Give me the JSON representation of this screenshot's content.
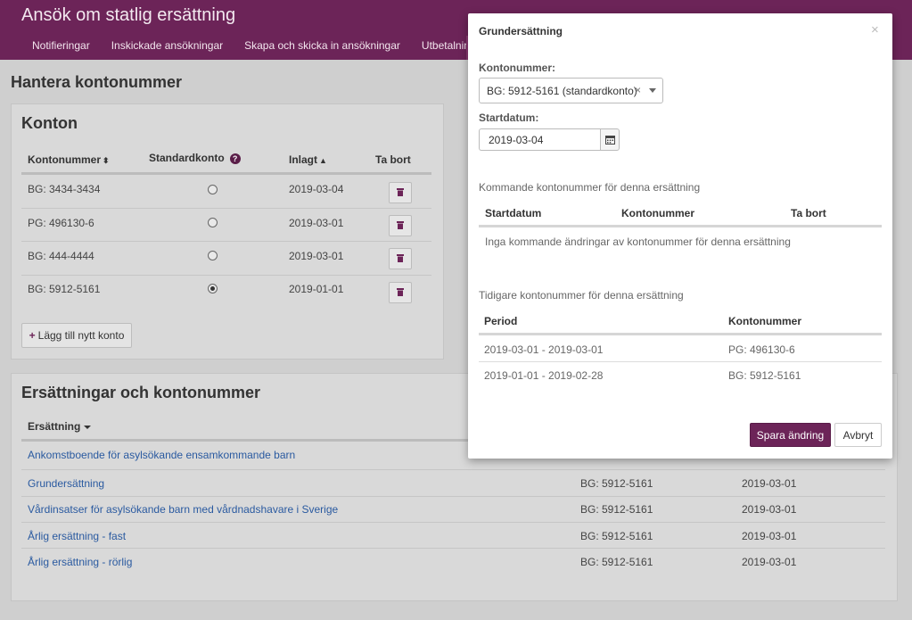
{
  "app": {
    "title": "Ansök om statlig ersättning"
  },
  "nav": [
    "Notifieringar",
    "Inskickade ansökningar",
    "Skapa och skicka in ansökningar",
    "Utbetalningar"
  ],
  "page": {
    "heading": "Hantera kontonummer"
  },
  "konton": {
    "title": "Konton",
    "headers": {
      "kontonummer": "Kontonummer",
      "standardkonto": "Standardkonto",
      "inlagt": "Inlagt",
      "ta_bort": "Ta bort"
    },
    "rows": [
      {
        "kontonummer": "BG: 3434-3434",
        "inlagt": "2019-03-04",
        "standard": false
      },
      {
        "kontonummer": "PG: 496130-6",
        "inlagt": "2019-03-01",
        "standard": false
      },
      {
        "kontonummer": "BG: 444-4444",
        "inlagt": "2019-03-01",
        "standard": false
      },
      {
        "kontonummer": "BG: 5912-5161",
        "inlagt": "2019-01-01",
        "standard": true
      }
    ],
    "add_button": "Lägg till nytt konto"
  },
  "ersattningar": {
    "title": "Ersättningar och kontonummer",
    "header_ersattning": "Ersättning",
    "rows": [
      {
        "name": "Ankomstboende för asylsökande ensamkommande barn",
        "konto": "",
        "datum": ""
      },
      {
        "name": "Grundersättning",
        "konto": "BG: 5912-5161",
        "datum": "2019-03-01"
      },
      {
        "name": "Vårdinsatser för asylsökande barn med vårdnadshavare i Sverige",
        "konto": "BG: 5912-5161",
        "datum": "2019-03-01"
      },
      {
        "name": "Årlig ersättning - fast",
        "konto": "BG: 5912-5161",
        "datum": "2019-03-01"
      },
      {
        "name": "Årlig ersättning - rörlig",
        "konto": "BG: 5912-5161",
        "datum": "2019-03-01"
      }
    ]
  },
  "modal": {
    "title": "Grundersättning",
    "close": "×",
    "kontonummer_label": "Kontonummer:",
    "kontonummer_value": "BG: 5912-5161 (standardkonto)",
    "clear": "×",
    "startdatum_label": "Startdatum:",
    "startdatum_value": "2019-03-04",
    "upcoming": {
      "title": "Kommande kontonummer för denna ersättning",
      "headers": [
        "Startdatum",
        "Kontonummer",
        "Ta bort"
      ],
      "empty": "Inga kommande ändringar av kontonummer för denna ersättning"
    },
    "previous": {
      "title": "Tidigare kontonummer för denna ersättning",
      "headers": [
        "Period",
        "Kontonummer"
      ],
      "rows": [
        {
          "period": "2019-03-01 - 2019-03-01",
          "konto": "PG: 496130-6"
        },
        {
          "period": "2019-01-01 - 2019-02-28",
          "konto": "BG: 5912-5161"
        }
      ]
    },
    "save": "Spara ändring",
    "cancel": "Avbryt"
  },
  "colors": {
    "brand": "#6c2458",
    "link": "#2a5aa0"
  }
}
